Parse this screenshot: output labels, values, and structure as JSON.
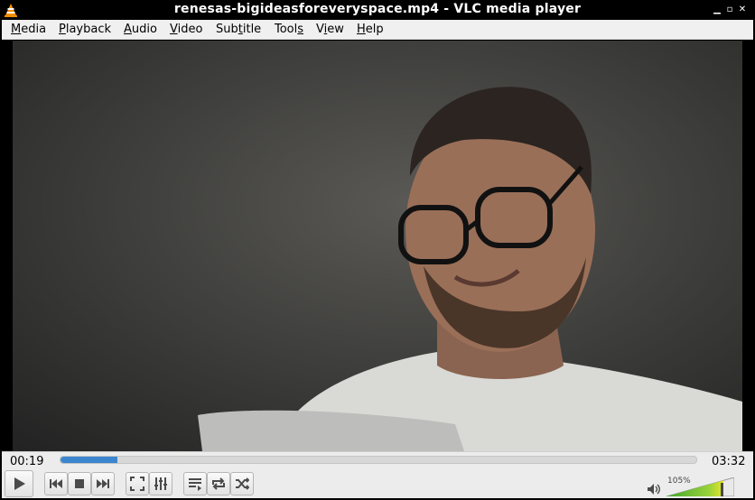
{
  "window": {
    "title": "renesas-bigideasforeveryspace.mp4 - VLC media player",
    "app_icon": "vlc-cone-icon",
    "controls": [
      "minimize-icon",
      "maximize-icon",
      "close-icon"
    ]
  },
  "menubar": {
    "items": [
      {
        "label": "Media",
        "accel": "M"
      },
      {
        "label": "Playback",
        "accel": "P"
      },
      {
        "label": "Audio",
        "accel": "A"
      },
      {
        "label": "Video",
        "accel": "V"
      },
      {
        "label": "Subtitle",
        "accel": "t"
      },
      {
        "label": "Tools",
        "accel": "s"
      },
      {
        "label": "View",
        "accel": "i"
      },
      {
        "label": "Help",
        "accel": "H"
      }
    ]
  },
  "playback": {
    "elapsed": "00:19",
    "total": "03:32",
    "progress_percent": 9
  },
  "buttons": {
    "play": "play-icon",
    "previous": "previous-icon",
    "stop": "stop-icon",
    "next": "next-icon",
    "fullscreen": "fullscreen-icon",
    "extended": "equalizer-icon",
    "playlist": "playlist-icon",
    "loop": "loop-icon",
    "shuffle": "shuffle-icon"
  },
  "volume": {
    "label": "105%",
    "level_percent": 105,
    "icon": "speaker-icon"
  },
  "colors": {
    "seek_fill": "#3b86cf",
    "volume_low": "#3fa72f",
    "volume_high": "#e5e52a"
  }
}
